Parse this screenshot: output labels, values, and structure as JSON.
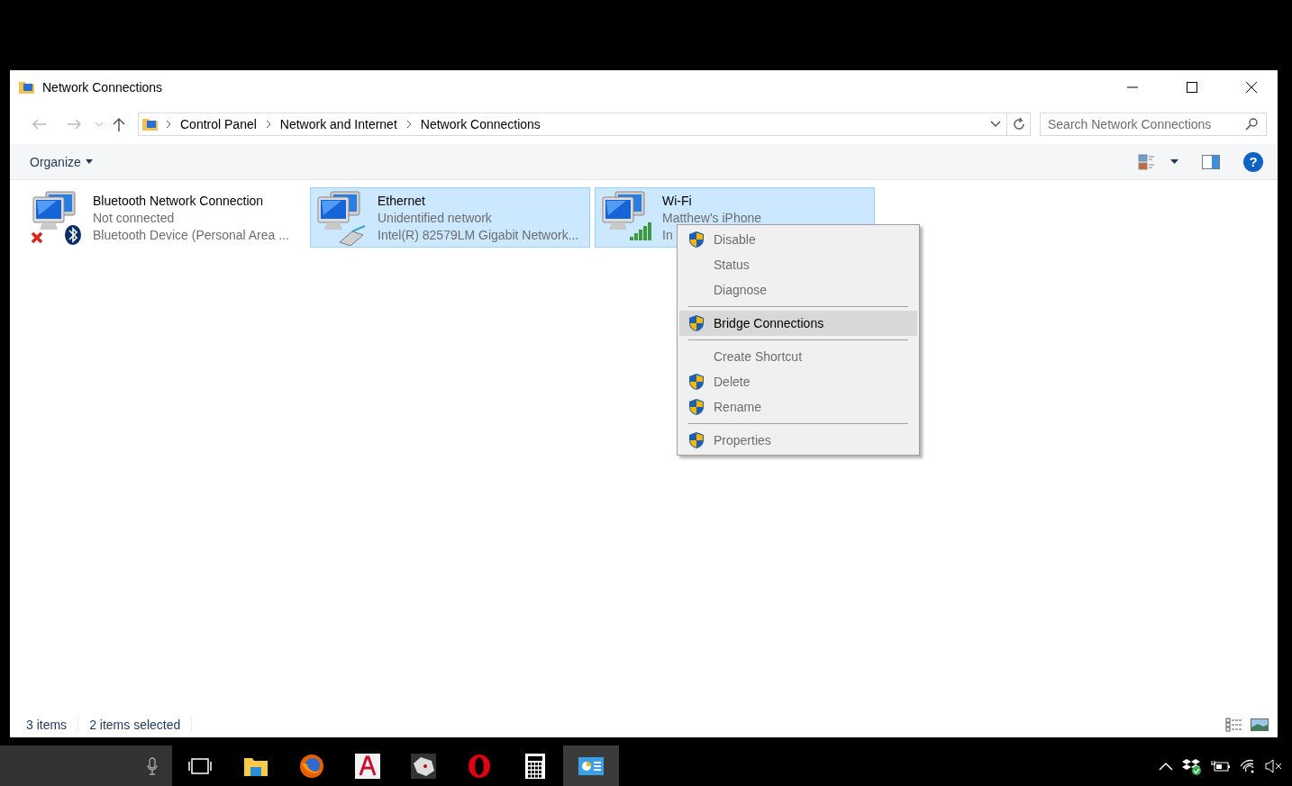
{
  "window": {
    "title": "Network Connections"
  },
  "address_bar": {
    "crumbs": [
      "Control Panel",
      "Network and Internet",
      "Network Connections"
    ]
  },
  "search": {
    "placeholder": "Search Network Connections"
  },
  "command_bar": {
    "organize": "Organize",
    "help": "?"
  },
  "connections": [
    {
      "kind": "bluetooth",
      "name": "Bluetooth Network Connection",
      "status": "Not connected",
      "device": "Bluetooth Device (Personal Area ...",
      "selected": false
    },
    {
      "kind": "ethernet",
      "name": "Ethernet",
      "status": "Unidentified network",
      "device": "Intel(R) 82579LM Gigabit Network...",
      "selected": true
    },
    {
      "kind": "wifi",
      "name": "Wi-Fi",
      "status": "Matthew's iPhone",
      "device": "In",
      "selected": true
    }
  ],
  "context_menu": [
    {
      "kind": "item",
      "label": "Disable",
      "shield": true,
      "selected": false
    },
    {
      "kind": "item",
      "label": "Status",
      "shield": false,
      "selected": false
    },
    {
      "kind": "item",
      "label": "Diagnose",
      "shield": false,
      "selected": false
    },
    {
      "kind": "separator"
    },
    {
      "kind": "item",
      "label": "Bridge Connections",
      "shield": true,
      "selected": true
    },
    {
      "kind": "separator"
    },
    {
      "kind": "item",
      "label": "Create Shortcut",
      "shield": false,
      "selected": false
    },
    {
      "kind": "item",
      "label": "Delete",
      "shield": true,
      "selected": false
    },
    {
      "kind": "item",
      "label": "Rename",
      "shield": true,
      "selected": false
    },
    {
      "kind": "separator"
    },
    {
      "kind": "item",
      "label": "Properties",
      "shield": true,
      "selected": false
    }
  ],
  "status_bar": {
    "count": "3 items",
    "selection": "2 items selected"
  },
  "taskbar": {
    "apps": [
      {
        "kind": "taskview",
        "selected": false
      },
      {
        "kind": "explorer",
        "selected": false
      },
      {
        "kind": "firefox",
        "selected": false
      },
      {
        "kind": "autocad",
        "selected": false
      },
      {
        "kind": "rhino",
        "selected": false
      },
      {
        "kind": "opera",
        "selected": false
      },
      {
        "kind": "calculator",
        "selected": false
      },
      {
        "kind": "controlpanel",
        "selected": true
      }
    ]
  }
}
